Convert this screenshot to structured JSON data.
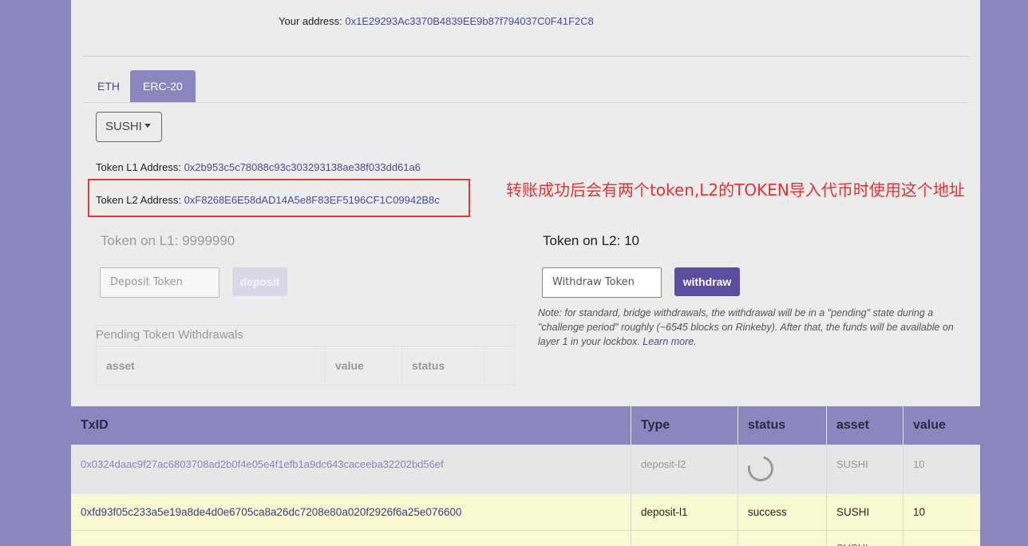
{
  "header": {
    "address_label": "Your address: ",
    "address_value": "0x1E29293Ac3370B4839EE9b87f794037C0F41F2C8"
  },
  "tabs": [
    {
      "label": "ETH",
      "active": false
    },
    {
      "label": "ERC-20",
      "active": true
    }
  ],
  "token_select": {
    "selected": "SUSHI"
  },
  "token_l1": {
    "label": "Token L1 Address: ",
    "value": "0x2b953c5c78088c93c303293138ae38f033dd61a6"
  },
  "token_l2": {
    "label": "Token L2 Address: ",
    "value": "0xF8268E6E58dAD14A5e8F83EF5196CF1C09942B8c"
  },
  "annotation": "转账成功后会有两个token,L2的TOKEN导入代币时使用这个地址",
  "l1": {
    "balance_label": "Token on L1: 9999990",
    "input_placeholder": "Deposit Token",
    "button_label": "deposit"
  },
  "l2": {
    "balance_label": "Token on L2: 10",
    "input_placeholder": "Withdraw Token",
    "button_label": "withdraw",
    "note": "Note: for standard, bridge withdrawals, the withdrawal will be in a \"pending\" state during a \"challenge period\" roughly (~6545 blocks on Rinkeby). After that, the funds will be available on layer 1 in your lockbox. ",
    "note_link": "Learn more."
  },
  "pending": {
    "title": "Pending Token Withdrawals",
    "columns": [
      "asset",
      "value",
      "status",
      ""
    ]
  },
  "transactions": {
    "columns": [
      "TxID",
      "Type",
      "status",
      "asset",
      "value"
    ],
    "rows": [
      {
        "txid": "0x0324daac9f27ac6803708ad2b0f4e05e4f1efb1a9dc643caceeba32202bd56ef",
        "type": "deposit-l2",
        "status": "",
        "asset": "SUSHI",
        "value": "10"
      },
      {
        "txid": "0xfd93f05c233a5e19a8de4d0e6705ca8a26dc7208e80a020f2926f6a25e076600",
        "type": "deposit-l1",
        "status": "success",
        "asset": "SUSHI",
        "value": "10"
      },
      {
        "txid": "",
        "type": "",
        "status": "",
        "asset": "SUSHI",
        "value": ""
      }
    ]
  },
  "colors": {
    "accent": "#8a86be",
    "button": "#5a4ea0",
    "highlight_border": "#e23a3a",
    "annotation_text": "#e43232",
    "row_success_bg": "#fafad2"
  }
}
